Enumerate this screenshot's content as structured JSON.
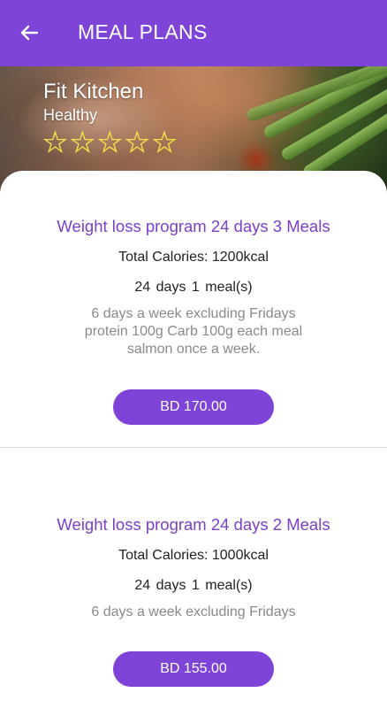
{
  "appbar": {
    "title": "MEAL PLANS",
    "back_icon": "arrow-left-icon",
    "background": "#7e44d8"
  },
  "restaurant": {
    "name": "Fit Kitchen",
    "category": "Healthy",
    "rating": 0,
    "rating_max": 5,
    "star_color": "#f7e34a"
  },
  "plans": [
    {
      "title": "Weight loss program 24 days 3 Meals",
      "calories": "Total Calories: 1200kcal",
      "days": "24 days  1 meal(s)",
      "description": [
        "6 days a week excluding Fridays",
        "protein 100g Carb 100g each meal",
        "salmon once a week."
      ],
      "price": "BD 170.00"
    },
    {
      "title": "Weight loss program 24 days 2 Meals",
      "calories": "Total Calories: 1000kcal",
      "days": "24 days  1 meal(s)",
      "description": [
        "6 days a week excluding Fridays"
      ],
      "price": "BD 155.00"
    }
  ],
  "colors": {
    "accent": "#7e44d8",
    "plan_title": "#7b3fc9",
    "muted_text": "#8a8a8a"
  }
}
